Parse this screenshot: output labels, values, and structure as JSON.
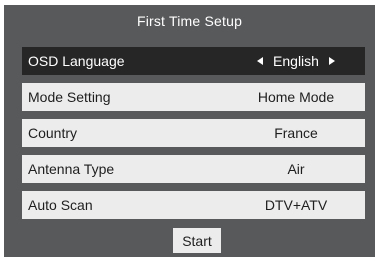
{
  "title": "First Time Setup",
  "rows": [
    {
      "label": "OSD Language",
      "value": "English",
      "selected": true
    },
    {
      "label": "Mode Setting",
      "value": "Home Mode"
    },
    {
      "label": "Country",
      "value": "France"
    },
    {
      "label": "Antenna Type",
      "value": "Air"
    },
    {
      "label": "Auto Scan",
      "value": "DTV+ATV"
    }
  ],
  "start_label": "Start",
  "icons": {
    "prev": "arrow-left-icon",
    "next": "arrow-right-icon"
  },
  "colors": {
    "panel": "#58595b",
    "row": "#ececec",
    "selected_row": "#262626",
    "text_dark": "#1e1e1e",
    "text_light": "#ffffff"
  }
}
